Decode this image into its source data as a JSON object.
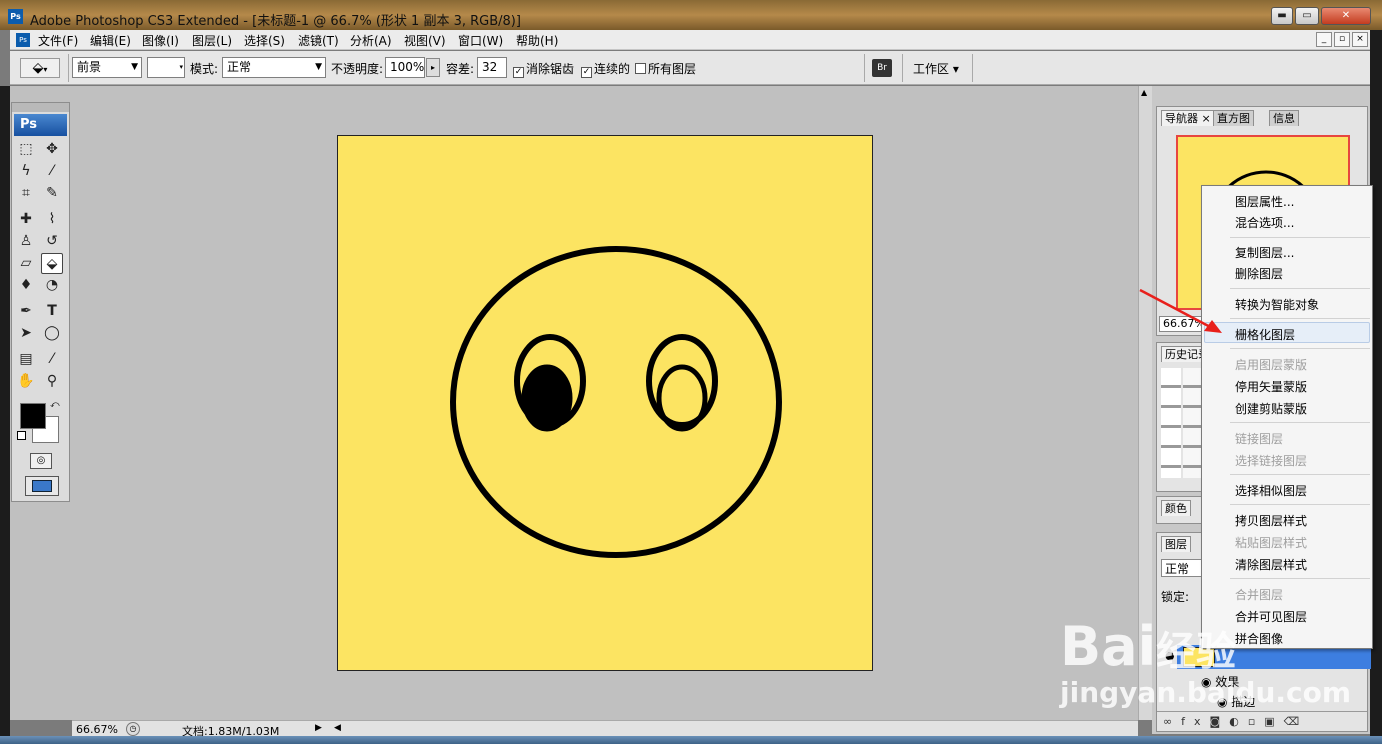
{
  "window": {
    "title": "Adobe Photoshop CS3 Extended - [未标题-1 @ 66.7% (形状 1 副本 3, RGB/8)]",
    "min_glyph": "▬",
    "max_glyph": "▭",
    "close_glyph": "✕"
  },
  "menu": {
    "app_icon": "Ps",
    "items": [
      "文件(F)",
      "编辑(E)",
      "图像(I)",
      "图层(L)",
      "选择(S)",
      "滤镜(T)",
      "分析(A)",
      "视图(V)",
      "窗口(W)",
      "帮助(H)"
    ]
  },
  "options": {
    "fill_source": "前景",
    "mode_label": "模式:",
    "mode_value": "正常",
    "opacity_label": "不透明度:",
    "opacity_value": "100%",
    "tolerance_label": "容差:",
    "tolerance_value": "32",
    "antialias_label": "消除锯齿",
    "antialias_checked": true,
    "contiguous_label": "连续的",
    "contiguous_checked": true,
    "all_layers_label": "所有图层",
    "all_layers_checked": false,
    "workspace_label": "工作区 ▾"
  },
  "toolbox": {
    "logo": "Ps",
    "foreground_color": "#000000",
    "background_color": "#ffffff",
    "active_tool": "paint-bucket"
  },
  "navigator": {
    "tabs": [
      "导航器",
      "直方图",
      "信息"
    ],
    "zoom": "66.67%"
  },
  "history": {
    "tab": "历史记录"
  },
  "color_panel": {
    "tab": "颜色"
  },
  "layers": {
    "tab": "图层",
    "blend_mode": "正常",
    "lock_label": "锁定:",
    "effects_label": "效果",
    "stroke_label": "描边"
  },
  "context_menu": {
    "items": [
      {
        "label": "图层属性...",
        "disabled": false
      },
      {
        "label": "混合选项...",
        "disabled": false
      },
      {
        "label": "复制图层...",
        "disabled": false
      },
      {
        "label": "删除图层",
        "disabled": false
      },
      {
        "label": "转换为智能对象",
        "disabled": false
      },
      {
        "label": "栅格化图层",
        "disabled": false,
        "highlighted": true
      },
      {
        "label": "启用图层蒙版",
        "disabled": true
      },
      {
        "label": "停用矢量蒙版",
        "disabled": false
      },
      {
        "label": "创建剪贴蒙版",
        "disabled": false
      },
      {
        "label": "链接图层",
        "disabled": true
      },
      {
        "label": "选择链接图层",
        "disabled": true
      },
      {
        "label": "选择相似图层",
        "disabled": false
      },
      {
        "label": "拷贝图层样式",
        "disabled": false
      },
      {
        "label": "粘贴图层样式",
        "disabled": true
      },
      {
        "label": "清除图层样式",
        "disabled": false
      },
      {
        "label": "合并图层",
        "disabled": true
      },
      {
        "label": "合并可见图层",
        "disabled": false
      },
      {
        "label": "拼合图像",
        "disabled": false
      }
    ]
  },
  "status": {
    "zoom": "66.67%",
    "doc": "文档:1.83M/1.03M"
  },
  "canvas": {
    "fill_color": "#fce462",
    "stroke_color": "#000000"
  },
  "watermark": {
    "brand": "Bai",
    "brand2": "经验",
    "url": "jingyan.baidu.com"
  },
  "colors": {
    "annotation_arrow": "#e8201c",
    "highlight": "#e6eef8"
  }
}
